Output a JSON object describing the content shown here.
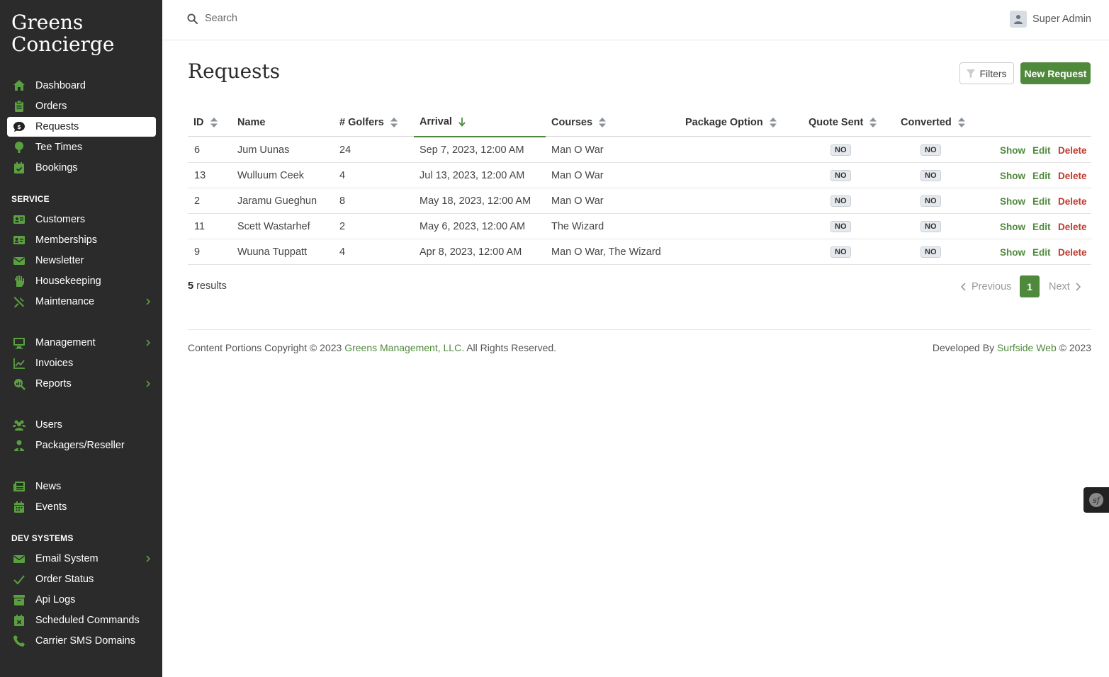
{
  "brand": {
    "line1": "Greens",
    "line2": "Concierge"
  },
  "sidebar": {
    "main": [
      {
        "label": "Dashboard",
        "icon": "home-icon"
      },
      {
        "label": "Orders",
        "icon": "clipboard-icon"
      },
      {
        "label": "Requests",
        "icon": "dollar-bubble-icon",
        "active": true
      },
      {
        "label": "Tee Times",
        "icon": "golf-ball-icon"
      },
      {
        "label": "Bookings",
        "icon": "calendar-check-icon"
      }
    ],
    "service_title": "SERVICE",
    "service": [
      {
        "label": "Customers",
        "icon": "address-card-icon"
      },
      {
        "label": "Memberships",
        "icon": "id-card-icon"
      },
      {
        "label": "Newsletter",
        "icon": "envelope-icon"
      },
      {
        "label": "Housekeeping",
        "icon": "hand-sparkles-icon"
      },
      {
        "label": "Maintenance",
        "icon": "tools-icon",
        "submenu": true
      }
    ],
    "admin": [
      {
        "label": "Management",
        "icon": "desktop-icon",
        "submenu": true
      },
      {
        "label": "Invoices",
        "icon": "chart-line-icon"
      },
      {
        "label": "Reports",
        "icon": "search-chart-icon",
        "submenu": true
      }
    ],
    "people": [
      {
        "label": "Users",
        "icon": "users-icon"
      },
      {
        "label": "Packagers/Reseller",
        "icon": "user-tie-icon"
      }
    ],
    "content": [
      {
        "label": "News",
        "icon": "newspaper-icon"
      },
      {
        "label": "Events",
        "icon": "calendar-icon"
      }
    ],
    "dev_title": "DEV SYSTEMS",
    "dev": [
      {
        "label": "Email System",
        "icon": "envelope-icon",
        "submenu": true
      },
      {
        "label": "Order Status",
        "icon": "check-icon"
      },
      {
        "label": "Api Logs",
        "icon": "archive-icon"
      },
      {
        "label": "Scheduled Commands",
        "icon": "calendar-x-icon"
      },
      {
        "label": "Carrier SMS Domains",
        "icon": "phone-icon"
      }
    ]
  },
  "topbar": {
    "search_placeholder": "Search",
    "user_name": "Super Admin"
  },
  "page": {
    "title": "Requests",
    "filters_label": "Filters",
    "new_label": "New Request"
  },
  "table": {
    "columns": [
      "ID",
      "Name",
      "# Golfers",
      "Arrival",
      "Courses",
      "Package Option",
      "Quote Sent",
      "Converted"
    ],
    "sorted_column": "Arrival",
    "rows": [
      {
        "id": "6",
        "name": "Jum Uunas",
        "golfers": "24",
        "arrival": "Sep 7, 2023, 12:00 AM",
        "courses": "Man O War",
        "package": "",
        "quote": "NO",
        "converted": "NO"
      },
      {
        "id": "13",
        "name": "Wulluum Ceek",
        "golfers": "4",
        "arrival": "Jul 13, 2023, 12:00 AM",
        "courses": "Man O War",
        "package": "",
        "quote": "NO",
        "converted": "NO"
      },
      {
        "id": "2",
        "name": "Jaramu Gueghun",
        "golfers": "8",
        "arrival": "May 18, 2023, 12:00 AM",
        "courses": "Man O War",
        "package": "",
        "quote": "NO",
        "converted": "NO"
      },
      {
        "id": "11",
        "name": "Scett Wastarhef",
        "golfers": "2",
        "arrival": "May 6, 2023, 12:00 AM",
        "courses": "The Wizard",
        "package": "",
        "quote": "NO",
        "converted": "NO"
      },
      {
        "id": "9",
        "name": "Wuuna Tuppatt",
        "golfers": "4",
        "arrival": "Apr 8, 2023, 12:00 AM",
        "courses": "Man O War, The Wizard",
        "package": "",
        "quote": "NO",
        "converted": "NO"
      }
    ],
    "actions": {
      "show": "Show",
      "edit": "Edit",
      "delete": "Delete"
    }
  },
  "results": {
    "count": "5",
    "label": "results"
  },
  "pagination": {
    "previous": "Previous",
    "current": "1",
    "next": "Next"
  },
  "footer": {
    "left_prefix": "Content Portions Copyright © 2023",
    "left_link": "Greens Management, LLC.",
    "left_suffix": "All Rights Reserved.",
    "right_prefix": "Developed By",
    "right_link": "Surfside Web",
    "right_suffix": "© 2023"
  },
  "colors": {
    "sidebar_bg": "#2b2b2b",
    "accent": "#4f8a3c",
    "danger": "#c0392b"
  }
}
